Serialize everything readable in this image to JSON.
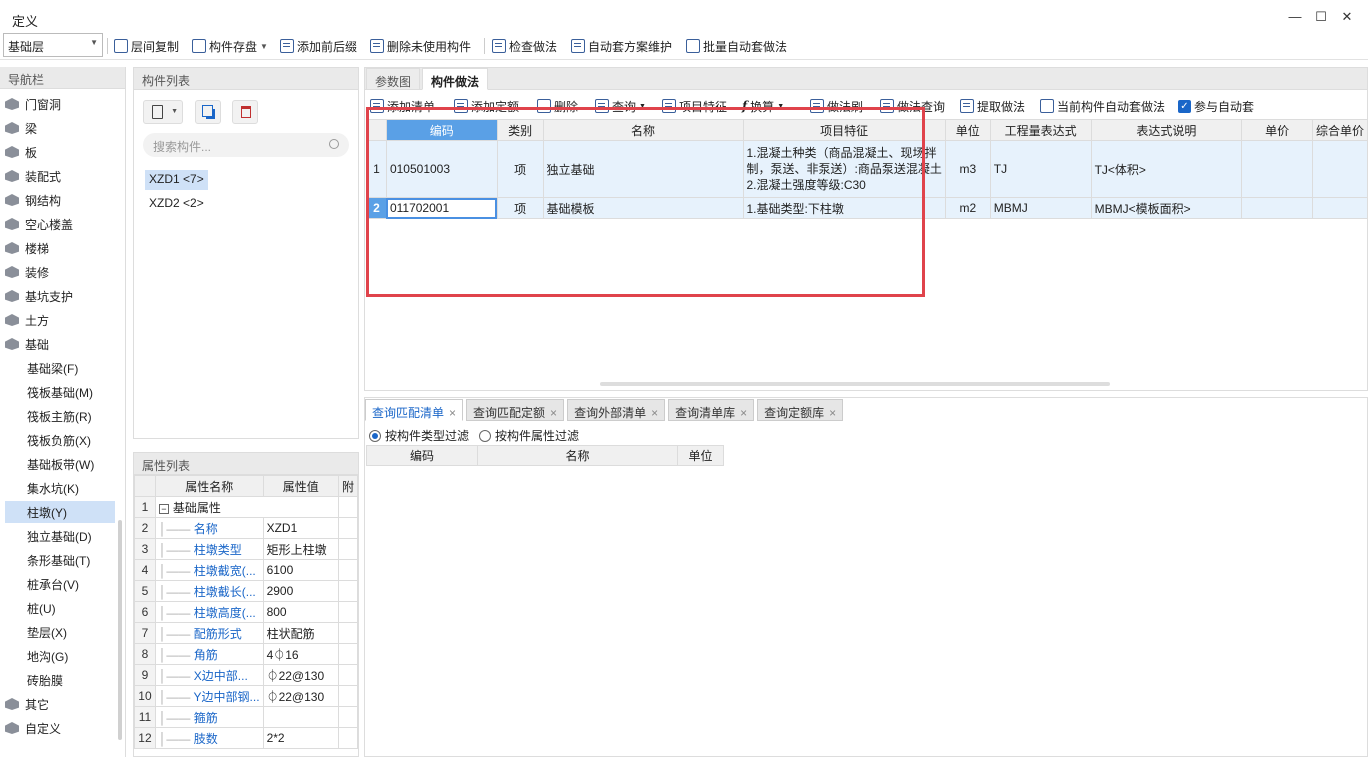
{
  "window": {
    "title": "定义"
  },
  "toolbar": {
    "floor_select": "基础层",
    "buttons": [
      "层间复制",
      "构件存盘",
      "添加前后缀",
      "删除未使用构件",
      "检查做法",
      "自动套方案维护",
      "批量自动套做法"
    ]
  },
  "nav": {
    "header": "导航栏",
    "items": [
      {
        "label": "门窗洞",
        "icon": "door-window-icon"
      },
      {
        "label": "梁",
        "icon": "beam-icon"
      },
      {
        "label": "板",
        "icon": "slab-icon"
      },
      {
        "label": "装配式",
        "icon": "prefab-icon"
      },
      {
        "label": "钢结构",
        "icon": "steel-icon"
      },
      {
        "label": "空心楼盖",
        "icon": "hollow-floor-icon"
      },
      {
        "label": "楼梯",
        "icon": "stair-icon"
      },
      {
        "label": "装修",
        "icon": "decoration-icon"
      },
      {
        "label": "基坑支护",
        "icon": "pit-support-icon"
      },
      {
        "label": "土方",
        "icon": "earthwork-icon"
      },
      {
        "label": "基础",
        "icon": "foundation-icon"
      }
    ],
    "sub_items": [
      "基础梁(F)",
      "筏板基础(M)",
      "筏板主筋(R)",
      "筏板负筋(X)",
      "基础板带(W)",
      "集水坑(K)",
      "柱墩(Y)",
      "独立基础(D)",
      "条形基础(T)",
      "桩承台(V)",
      "桩(U)",
      "垫层(X)",
      "地沟(G)",
      "砖胎膜"
    ],
    "tail_items": [
      {
        "label": "其它",
        "icon": "other-icon"
      },
      {
        "label": "自定义",
        "icon": "custom-icon"
      }
    ],
    "selected": "柱墩(Y)"
  },
  "component_list": {
    "header": "构件列表",
    "search_placeholder": "搜索构件...",
    "items": [
      "XZD1 <7>",
      "XZD2 <2>"
    ]
  },
  "properties": {
    "header": "属性列表",
    "columns": [
      "属性名称",
      "属性值",
      "附"
    ],
    "group": "基础属性",
    "rows": [
      {
        "n": "2",
        "name": "名称",
        "value": "XZD1"
      },
      {
        "n": "3",
        "name": "柱墩类型",
        "value": "矩形上柱墩"
      },
      {
        "n": "4",
        "name": "柱墩截宽(...",
        "value": "6100"
      },
      {
        "n": "5",
        "name": "柱墩截长(...",
        "value": "2900"
      },
      {
        "n": "6",
        "name": "柱墩高度(...",
        "value": "800"
      },
      {
        "n": "7",
        "name": "配筋形式",
        "value": "柱状配筋"
      },
      {
        "n": "8",
        "name": "角筋",
        "value": "4⏀16"
      },
      {
        "n": "9",
        "name": "X边中部...",
        "value": "⏀22@130"
      },
      {
        "n": "10",
        "name": "Y边中部钢...",
        "value": "⏀22@130"
      },
      {
        "n": "11",
        "name": "箍筋",
        "value": ""
      },
      {
        "n": "12",
        "name": "肢数",
        "value": "2*2"
      }
    ]
  },
  "main": {
    "tabs": [
      "参数图",
      "构件做法"
    ],
    "active_tab": "构件做法",
    "actions": [
      "添加清单",
      "添加定额",
      "删除",
      "查询",
      "项目特征",
      "换算",
      "做法刷",
      "做法查询",
      "提取做法",
      "当前构件自动套做法",
      "参与自动套"
    ],
    "columns": [
      "编码",
      "类别",
      "名称",
      "项目特征",
      "单位",
      "工程量表达式",
      "表达式说明",
      "单价",
      "综合单价"
    ],
    "rows": [
      {
        "n": "1",
        "code": "010501003",
        "type": "项",
        "name": "独立基础",
        "feature": [
          "1.混凝土种类（商品混凝土、现场拌",
          "制，泵送、非泵送）:商品泵送混凝土",
          "2.混凝土强度等级:C30"
        ],
        "unit": "m3",
        "expr": "TJ",
        "desc": "TJ<体积>",
        "price": "",
        "total": ""
      },
      {
        "n": "2",
        "code": "011702001",
        "type": "项",
        "name": "基础模板",
        "feature": [
          "1.基础类型:下柱墩"
        ],
        "unit": "m2",
        "expr": "MBMJ",
        "desc": "MBMJ<模板面积>",
        "price": "",
        "total": ""
      }
    ]
  },
  "lower": {
    "tabs": [
      "查询匹配清单",
      "查询匹配定额",
      "查询外部清单",
      "查询清单库",
      "查询定额库"
    ],
    "active_tab": "查询匹配清单",
    "filters": [
      "按构件类型过滤",
      "按构件属性过滤"
    ],
    "columns": [
      "编码",
      "名称",
      "单位"
    ]
  },
  "colors": {
    "accent": "#1a66c8",
    "highlight_box": "#e0434b",
    "selection": "#cfe1f7"
  }
}
